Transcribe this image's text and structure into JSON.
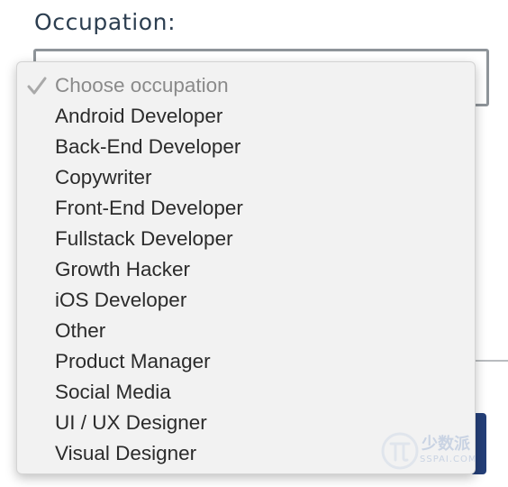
{
  "form": {
    "occupation_label": "Occupation:",
    "select_selected_value": "Choose occupation"
  },
  "dropdown": {
    "selected_icon": "check-icon",
    "options": [
      "Choose occupation",
      "Android Developer",
      "Back-End Developer",
      "Copywriter",
      "Front-End Developer",
      "Fullstack Developer",
      "Growth Hacker",
      "iOS Developer",
      "Other",
      "Product Manager",
      "Social Media",
      "UI / UX Designer",
      "Visual Designer"
    ]
  },
  "watermark": {
    "text": "少数派",
    "sub": "SSPAI.COM"
  },
  "colors": {
    "label": "#2c3e50",
    "menu_background": "#f2f2f2",
    "option_text": "#2b2b2b",
    "placeholder_text": "#8a8a8a",
    "button": "#243f78"
  }
}
